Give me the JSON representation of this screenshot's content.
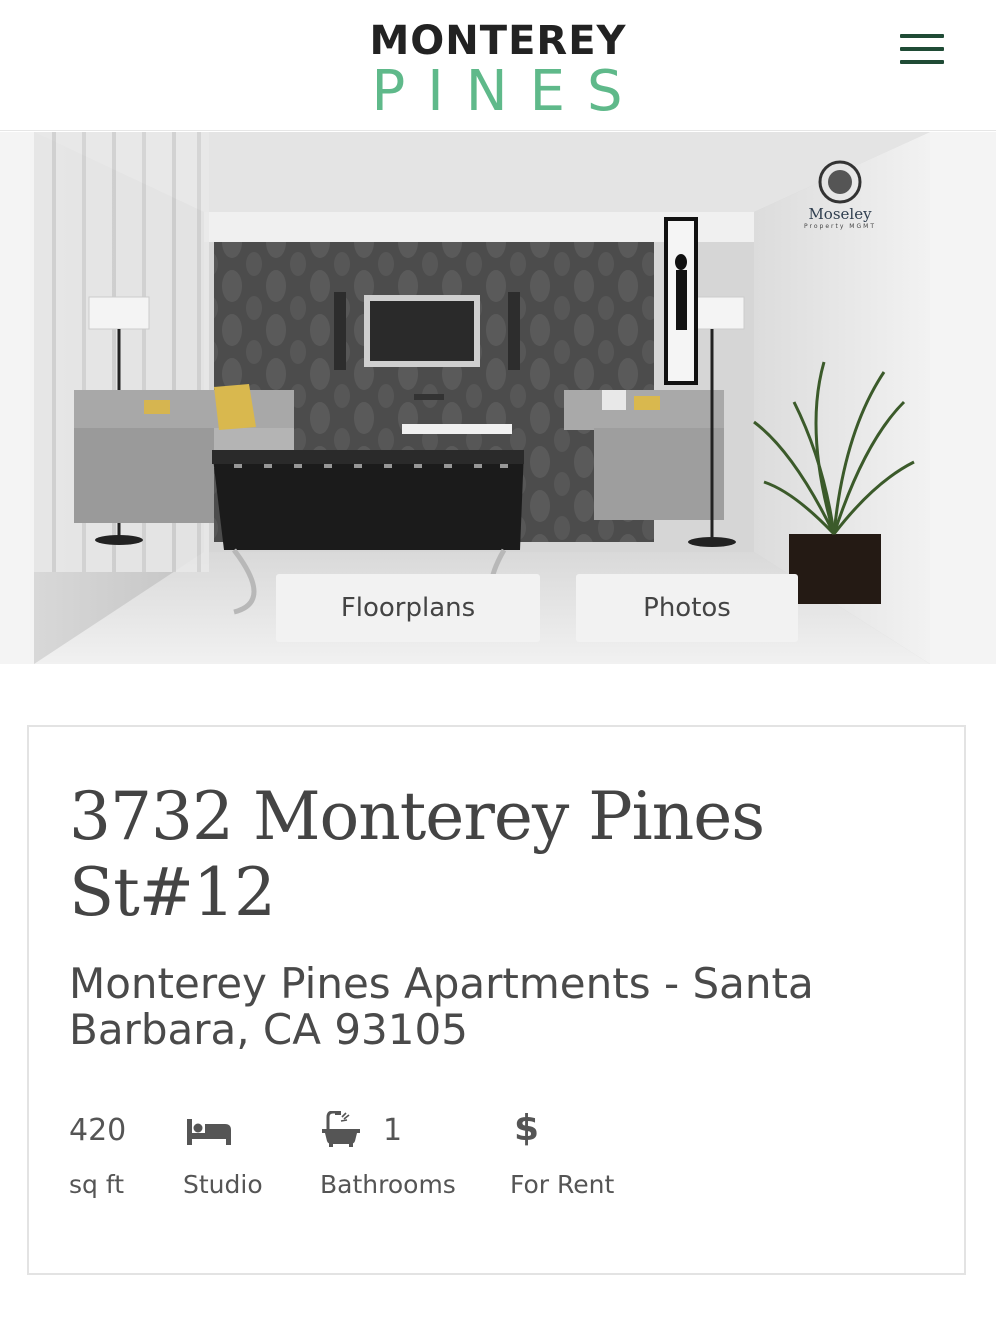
{
  "header": {
    "logo_top": "MONTEREY",
    "logo_bottom": "PINES",
    "menu_icon": "hamburger-menu-icon"
  },
  "hero": {
    "watermark_brand": "Moseley",
    "watermark_sub": "Property MGMT",
    "floorplans_label": "Floorplans",
    "photos_label": "Photos"
  },
  "listing": {
    "title_line1": "3732 Monterey Pines",
    "title_line2": "St#12",
    "subtitle_line1": "Monterey Pines Apartments - Santa",
    "subtitle_line2": "Barbara, CA 93105",
    "stats": {
      "area": {
        "value": "420",
        "label": "sq ft"
      },
      "bedrooms": {
        "icon": "bed-icon",
        "label": "Studio"
      },
      "bathrooms": {
        "icon": "bathtub-icon",
        "value": "1",
        "label": "Bathrooms"
      },
      "price": {
        "icon": "dollar-icon",
        "label": "For Rent"
      }
    }
  },
  "colors": {
    "logo_dark": "#222222",
    "logo_accent": "#5fb98a",
    "menu_icon": "#1f4b35",
    "text": "#444444",
    "card_border": "#e3e3e3",
    "button_bg": "#f2f2f2"
  }
}
